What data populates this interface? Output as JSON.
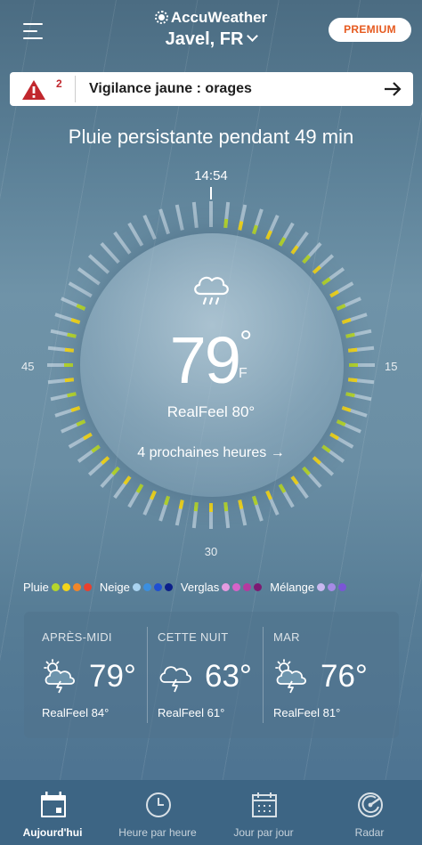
{
  "header": {
    "brand": "AccuWeather",
    "location": "Javel, FR",
    "premium_label": "PREMIUM"
  },
  "alert": {
    "count": "2",
    "text": "Vigilance jaune : orages",
    "icon": "warning-triangle-icon"
  },
  "headline": "Pluie persistante pendant 49 min",
  "dial": {
    "time_label": "14:54",
    "label_left": "45",
    "label_right": "15",
    "label_bottom": "30",
    "icon": "cloud-rain-icon",
    "temperature": "79",
    "degree": "°",
    "unit": "F",
    "realfeel": "RealFeel  80°",
    "next_hours": "4 prochaines heures →"
  },
  "legend": [
    {
      "label": "Pluie",
      "colors": [
        "#b6d62b",
        "#f2d51b",
        "#f0862a",
        "#e8402e"
      ]
    },
    {
      "label": "Neige",
      "colors": [
        "#a9d3f0",
        "#3b8fe0",
        "#1f4fd1",
        "#0b1f8a"
      ]
    },
    {
      "label": "Verglas",
      "colors": [
        "#e59be0",
        "#d763c9",
        "#b6399f",
        "#7c1b72"
      ]
    },
    {
      "label": "Mélange",
      "colors": [
        "#c9b8f0",
        "#a68ae6",
        "#7b55d6"
      ]
    }
  ],
  "forecast": [
    {
      "title": "APRÈS-MIDI",
      "temp": "79°",
      "realfeel": "RealFeel 84°",
      "icon": "sun-cloud-thunder-icon"
    },
    {
      "title": "CETTE NUIT",
      "temp": "63°",
      "realfeel": "RealFeel 61°",
      "icon": "cloud-thunder-icon"
    },
    {
      "title": "MAR",
      "temp": "76°",
      "realfeel": "RealFeel 81°",
      "icon": "sun-cloud-thunder-icon"
    }
  ],
  "nav": [
    {
      "label": "Aujourd'hui",
      "icon": "calendar-today-icon",
      "active": true
    },
    {
      "label": "Heure par heure",
      "icon": "clock-icon",
      "active": false
    },
    {
      "label": "Jour par jour",
      "icon": "calendar-icon",
      "active": false
    },
    {
      "label": "Radar",
      "icon": "radar-icon",
      "active": false
    }
  ],
  "colors": {
    "premium_text": "#e65a1f",
    "alert_red": "#c1272d",
    "rain_light": "#b6d62b",
    "rain_moderate": "#f2d51b"
  }
}
